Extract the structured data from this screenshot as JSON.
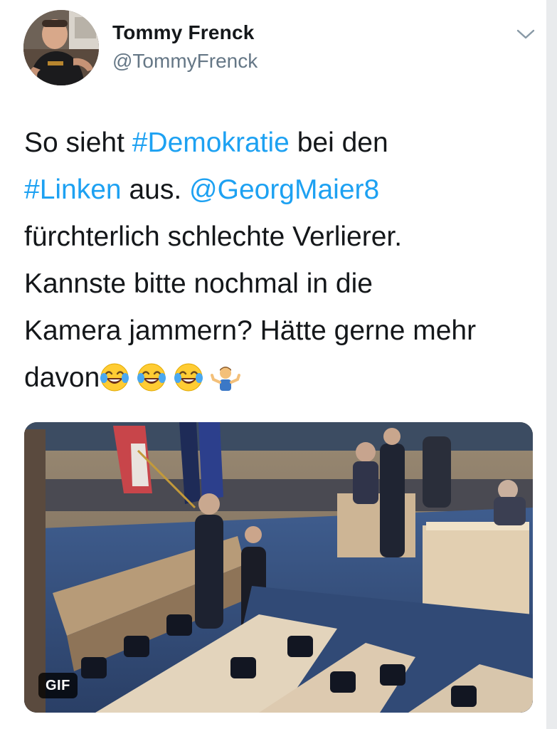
{
  "author": {
    "name": "Tommy Frenck",
    "handle": "@TommyFrenck"
  },
  "tweet": {
    "lines": [
      [
        {
          "text": "So sieht "
        },
        {
          "text": "#Demokratie",
          "link": true
        },
        {
          "text": " bei den"
        }
      ],
      [
        {
          "text": "#Linken",
          "link": true
        },
        {
          "text": " aus. "
        },
        {
          "text": "@GeorgMaier8",
          "link": true
        }
      ],
      [
        {
          "text": "fürchterlich schlechte Verlierer."
        }
      ],
      [
        {
          "text": "Kannste bitte nochmal in die"
        }
      ],
      [
        {
          "text": "Kamera jammern? Hätte gerne mehr"
        }
      ],
      [
        {
          "text": "davon"
        }
      ]
    ],
    "emojis": [
      "face-with-tears-of-joy",
      "face-with-tears-of-joy",
      "face-with-tears-of-joy",
      "person-shrugging"
    ]
  },
  "media": {
    "badge": "GIF",
    "description_icon": "parliament-video-gif"
  },
  "colors": {
    "link": "#1da1f2",
    "text": "#14171a",
    "secondary": "#657786"
  },
  "icons": {
    "menu": "chevron-down-icon"
  }
}
